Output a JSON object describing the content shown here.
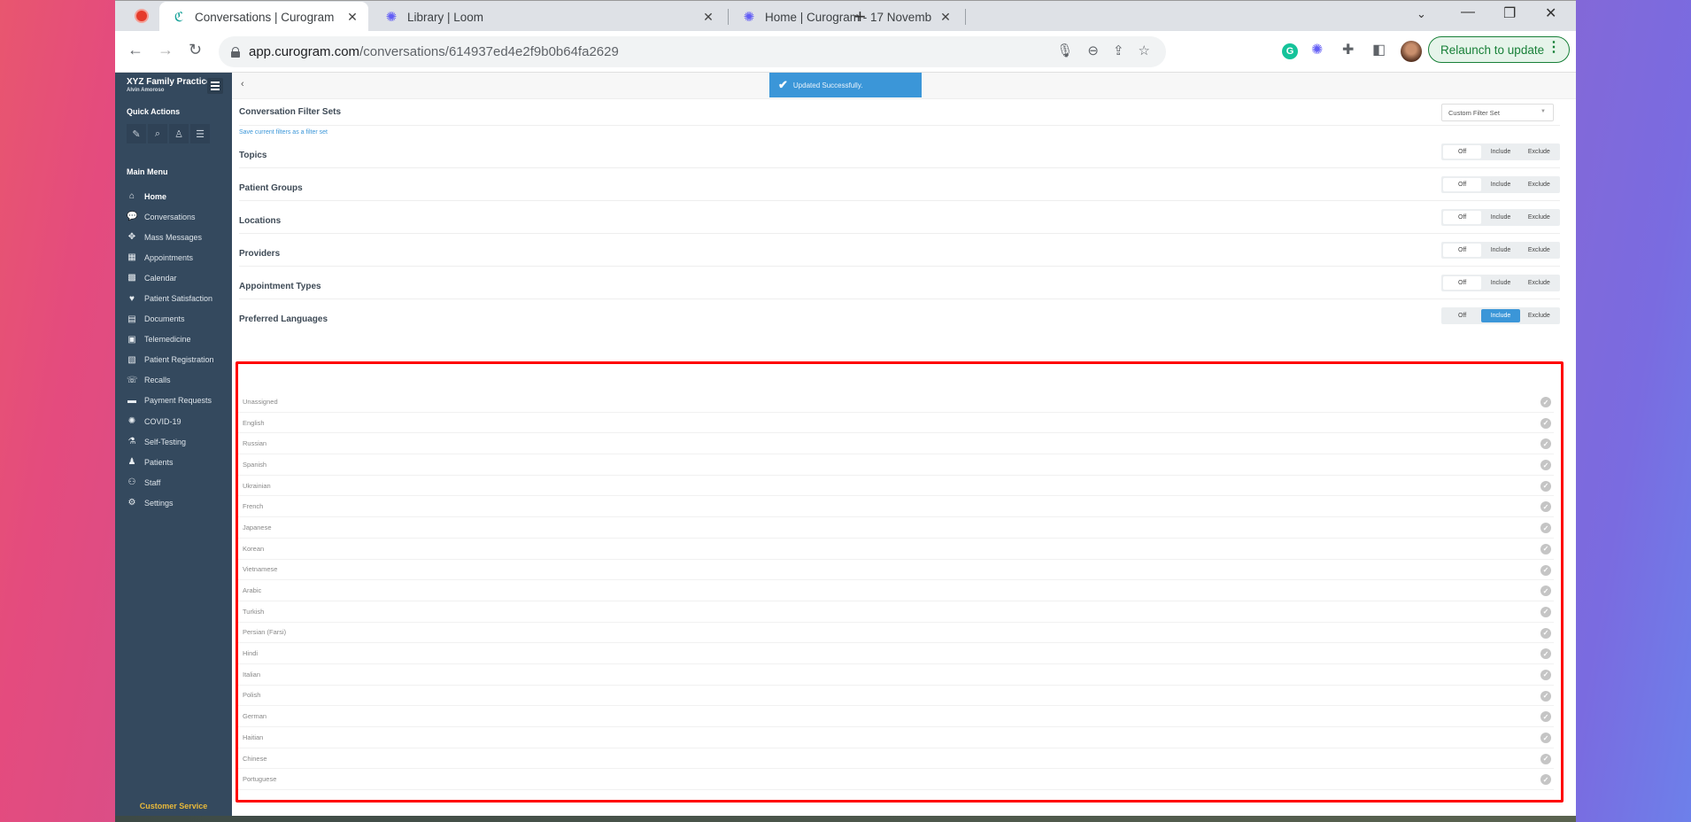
{
  "browser": {
    "tabs": [
      {
        "title": "Conversations | Curogram",
        "icon": "curogram-icon",
        "active": true
      },
      {
        "title": "Library | Loom",
        "icon": "loom-icon",
        "active": false
      },
      {
        "title": "Home | Curogram - 17 Novemb",
        "icon": "loom-icon",
        "active": false
      }
    ],
    "url_domain": "app.curogram.com",
    "url_path": "/conversations/614937ed4e2f9b0b64fa2629",
    "relaunch_label": "Relaunch to update"
  },
  "sidebar": {
    "practice_name": "XYZ Family Practice",
    "user_name": "Alvin Amoroso",
    "quick_actions_title": "Quick Actions",
    "quick_actions": [
      {
        "icon": "compose-icon",
        "glyph": "✎"
      },
      {
        "icon": "search-icon",
        "glyph": "⌕"
      },
      {
        "icon": "patient-icon",
        "glyph": "♙"
      },
      {
        "icon": "sliders-icon",
        "glyph": "☰"
      }
    ],
    "main_menu_title": "Main Menu",
    "items": [
      {
        "label": "Home",
        "icon": "home-icon",
        "glyph": "⌂",
        "active": true
      },
      {
        "label": "Conversations",
        "icon": "chat-icon",
        "glyph": "💬",
        "active": false
      },
      {
        "label": "Mass Messages",
        "icon": "broadcast-icon",
        "glyph": "✥",
        "active": false
      },
      {
        "label": "Appointments",
        "icon": "appointments-icon",
        "glyph": "▦",
        "active": false
      },
      {
        "label": "Calendar",
        "icon": "calendar-icon",
        "glyph": "▩",
        "active": false
      },
      {
        "label": "Patient Satisfaction",
        "icon": "heart-icon",
        "glyph": "♥",
        "active": false
      },
      {
        "label": "Documents",
        "icon": "documents-icon",
        "glyph": "▤",
        "active": false
      },
      {
        "label": "Telemedicine",
        "icon": "telemedicine-icon",
        "glyph": "▣",
        "active": false
      },
      {
        "label": "Patient Registration",
        "icon": "registration-icon",
        "glyph": "▧",
        "active": false
      },
      {
        "label": "Recalls",
        "icon": "recalls-icon",
        "glyph": "☏",
        "active": false
      },
      {
        "label": "Payment Requests",
        "icon": "credit-card-icon",
        "glyph": "▬",
        "active": false
      },
      {
        "label": "COVID-19",
        "icon": "virus-icon",
        "glyph": "✺",
        "active": false
      },
      {
        "label": "Self-Testing",
        "icon": "flask-icon",
        "glyph": "⚗",
        "active": false
      },
      {
        "label": "Patients",
        "icon": "patients-icon",
        "glyph": "♟",
        "active": false
      },
      {
        "label": "Staff",
        "icon": "staff-icon",
        "glyph": "⚇",
        "active": false
      },
      {
        "label": "Settings",
        "icon": "gear-icon",
        "glyph": "⚙",
        "active": false
      }
    ],
    "customer_service": "Customer Service"
  },
  "toast": {
    "message": "Updated Successfully."
  },
  "filter_sets": {
    "title": "Conversation Filter Sets",
    "save_link": "Save current filters as a filter set",
    "selected": "Custom Filter Set"
  },
  "segment_labels": {
    "off": "Off",
    "include": "Include",
    "exclude": "Exclude"
  },
  "filters": [
    {
      "title": "Topics",
      "state": "off"
    },
    {
      "title": "Patient Groups",
      "state": "off"
    },
    {
      "title": "Locations",
      "state": "off"
    },
    {
      "title": "Providers",
      "state": "off"
    },
    {
      "title": "Appointment Types",
      "state": "off"
    },
    {
      "title": "Preferred Languages",
      "state": "include"
    }
  ],
  "languages": [
    "Unassigned",
    "English",
    "Russian",
    "Spanish",
    "Ukrainian",
    "French",
    "Japanese",
    "Korean",
    "Vietnamese",
    "Arabic",
    "Turkish",
    "Persian (Farsi)",
    "Hindi",
    "Italian",
    "Polish",
    "German",
    "Haitian",
    "Chinese",
    "Portuguese"
  ]
}
